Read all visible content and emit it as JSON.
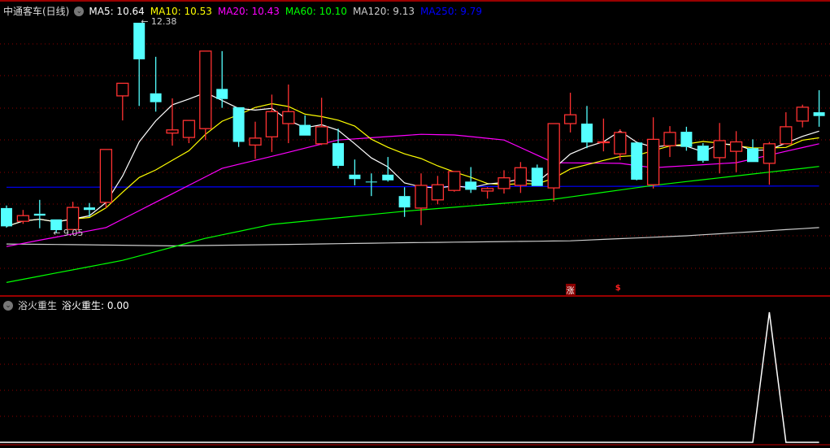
{
  "header": {
    "stock_name": "中通客车(日线)",
    "ma_labels": [
      {
        "text": "MA5: 10.64",
        "color": "#ffffff"
      },
      {
        "text": "MA10: 10.53",
        "color": "#ffff00"
      },
      {
        "text": "MA20: 10.43",
        "color": "#ff00ff"
      },
      {
        "text": "MA60: 10.10",
        "color": "#00ff00"
      },
      {
        "text": "MA120: 9.13",
        "color": "#cccccc"
      },
      {
        "text": "MA250: 9.79",
        "color": "#0000ff"
      }
    ]
  },
  "indicator": {
    "name": "浴火重生",
    "value_label": "浴火重生: 0.00"
  },
  "annotations": {
    "high_label": "12.38",
    "low_label": "9.05"
  },
  "markers": [
    {
      "index": 34,
      "text": "涨"
    },
    {
      "index": 37,
      "text": "$"
    }
  ],
  "colors": {
    "up": "#ff3232",
    "down": "#54ffff",
    "grid": "#8b0000",
    "divider": "#cc0000"
  },
  "chart_data": {
    "type": "candlestick",
    "candles": [
      [
        9.44,
        9.48,
        9.13,
        9.15
      ],
      [
        9.23,
        9.41,
        9.19,
        9.32
      ],
      [
        9.35,
        9.57,
        9.12,
        9.32
      ],
      [
        9.26,
        9.26,
        9.05,
        9.09
      ],
      [
        9.1,
        9.54,
        9.09,
        9.45
      ],
      [
        9.45,
        9.52,
        9.3,
        9.41
      ],
      [
        9.53,
        10.37,
        9.44,
        10.37
      ],
      [
        11.22,
        11.42,
        10.83,
        11.42
      ],
      [
        12.38,
        12.38,
        11.06,
        11.8
      ],
      [
        11.26,
        11.84,
        10.97,
        11.12
      ],
      [
        10.63,
        11.18,
        10.43,
        10.68
      ],
      [
        10.56,
        10.83,
        10.47,
        10.83
      ],
      [
        10.7,
        11.93,
        10.52,
        11.93
      ],
      [
        11.33,
        11.93,
        11.03,
        11.17
      ],
      [
        11.04,
        11.04,
        10.41,
        10.49
      ],
      [
        10.44,
        10.81,
        10.22,
        10.55
      ],
      [
        10.57,
        11.24,
        10.33,
        10.97
      ],
      [
        10.78,
        11.4,
        10.47,
        10.97
      ],
      [
        10.76,
        10.91,
        10.59,
        10.59
      ],
      [
        10.46,
        11.19,
        10.44,
        10.73
      ],
      [
        10.47,
        10.7,
        10.07,
        10.11
      ],
      [
        9.97,
        10.21,
        9.8,
        9.9
      ],
      [
        9.86,
        9.99,
        9.63,
        9.85
      ],
      [
        9.97,
        10.25,
        9.86,
        9.88
      ],
      [
        9.63,
        9.77,
        9.3,
        9.45
      ],
      [
        9.44,
        9.99,
        9.17,
        9.8
      ],
      [
        9.57,
        9.95,
        9.5,
        9.81
      ],
      [
        9.72,
        10.02,
        9.7,
        10.02
      ],
      [
        9.86,
        10.09,
        9.68,
        9.73
      ],
      [
        9.71,
        9.77,
        9.59,
        9.75
      ],
      [
        9.75,
        10.04,
        9.67,
        9.92
      ],
      [
        9.8,
        10.17,
        9.68,
        10.08
      ],
      [
        10.08,
        10.13,
        9.79,
        9.79
      ],
      [
        9.76,
        10.78,
        9.54,
        10.78
      ],
      [
        10.78,
        11.27,
        10.64,
        10.92
      ],
      [
        10.78,
        11.06,
        10.39,
        10.48
      ],
      [
        10.48,
        10.86,
        10.34,
        10.49
      ],
      [
        10.3,
        10.69,
        10.2,
        10.64
      ],
      [
        10.48,
        10.48,
        9.88,
        9.89
      ],
      [
        9.81,
        10.88,
        9.75,
        10.53
      ],
      [
        10.43,
        10.74,
        10.25,
        10.64
      ],
      [
        10.65,
        10.73,
        10.35,
        10.41
      ],
      [
        10.43,
        10.47,
        10.16,
        10.19
      ],
      [
        10.24,
        10.79,
        9.99,
        10.51
      ],
      [
        10.34,
        10.66,
        10.01,
        10.49
      ],
      [
        10.39,
        10.53,
        10.17,
        10.17
      ],
      [
        10.15,
        10.49,
        9.81,
        10.46
      ],
      [
        10.46,
        10.96,
        10.46,
        10.73
      ],
      [
        10.82,
        11.08,
        10.72,
        11.04
      ],
      [
        10.96,
        11.31,
        10.73,
        10.9
      ]
    ],
    "candle_format": [
      "open",
      "high",
      "low",
      "close"
    ],
    "ma_series": {
      "MA20": {
        "color": "#ff00ff",
        "points": [
          [
            0,
            8.83
          ],
          [
            6,
            9.13
          ],
          [
            13,
            10.07
          ],
          [
            16,
            10.26
          ],
          [
            20,
            10.52
          ],
          [
            25,
            10.61
          ],
          [
            27,
            10.6
          ],
          [
            30,
            10.52
          ],
          [
            33,
            10.16
          ],
          [
            37,
            10.15
          ],
          [
            39,
            10.08
          ],
          [
            44,
            10.16
          ],
          [
            49,
            10.46
          ]
        ]
      },
      "MA60": {
        "color": "#00ff00",
        "points": [
          [
            0,
            8.26
          ],
          [
            7,
            8.61
          ],
          [
            12,
            8.96
          ],
          [
            16,
            9.18
          ],
          [
            24,
            9.39
          ],
          [
            33,
            9.58
          ],
          [
            39,
            9.8
          ],
          [
            49,
            10.1
          ]
        ]
      },
      "MA120": {
        "color": "#cccccc",
        "points": [
          [
            0,
            8.87
          ],
          [
            4,
            8.86
          ],
          [
            10,
            8.84
          ],
          [
            16,
            8.86
          ],
          [
            24,
            8.89
          ],
          [
            34,
            8.92
          ],
          [
            41,
            9.0
          ],
          [
            49,
            9.13
          ]
        ]
      },
      "MA250": {
        "color": "#0000ff",
        "points": [
          [
            0,
            9.77
          ],
          [
            49,
            9.79
          ]
        ]
      }
    },
    "ma_computed": {
      "MA5": {
        "period": 5,
        "color": "#ffffff"
      },
      "MA10": {
        "period": 10,
        "color": "#ffff00"
      }
    },
    "indicator_values": [
      0,
      0,
      0,
      0,
      0,
      0,
      0,
      0,
      0,
      0,
      0,
      0,
      0,
      0,
      0,
      0,
      0,
      0,
      0,
      0,
      0,
      0,
      0,
      0,
      0,
      0,
      0,
      0,
      0,
      0,
      0,
      0,
      0,
      0,
      0,
      0,
      0,
      0,
      0,
      0,
      0,
      0,
      0,
      0,
      0,
      0,
      1,
      0,
      0,
      0
    ],
    "indicator_range": [
      0,
      1
    ],
    "grid": true
  }
}
